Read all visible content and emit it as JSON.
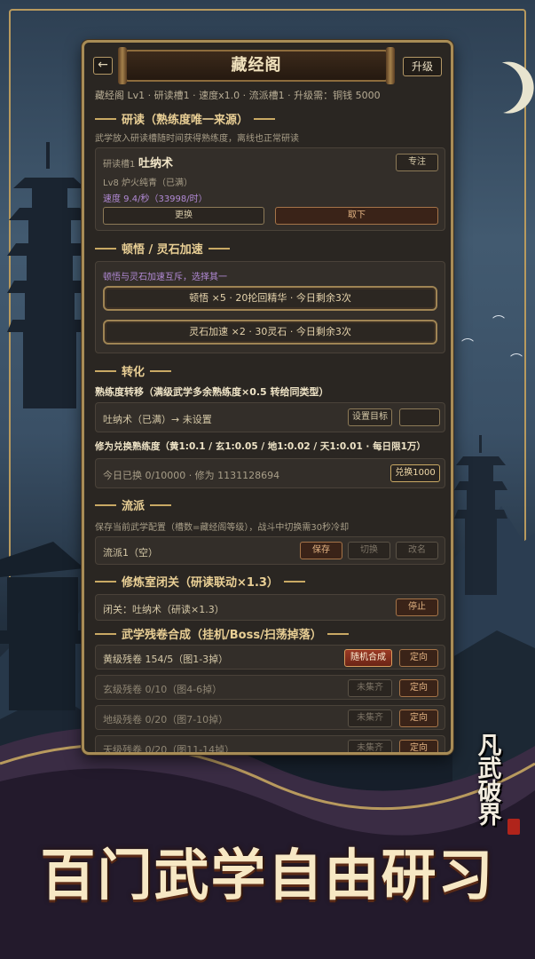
{
  "panel": {
    "back_glyph": "←",
    "title": "藏经阁",
    "upgrade_label": "升级",
    "status": "藏经阁 Lv1 · 研读槽1 · 速度x1.0 · 流派槽1 · 升级需：铜钱 5000"
  },
  "study": {
    "heading": "研读（熟练度唯一来源）",
    "note": "武学放入研读槽随时间获得熟练度，离线也正常研读",
    "slot_label": "研读槽1",
    "skill_name": "吐纳术",
    "detail_btn": "专注",
    "level_text": "Lv8 炉火纯青（已满）",
    "speed_text": "速度 9.4/秒（33998/时）",
    "swap_btn": "更换",
    "remove_btn": "取下"
  },
  "boost": {
    "heading": "顿悟 / 灵石加速",
    "note": "顿悟与灵石加速互斥，选择其一",
    "option1": "顿悟 ×5 · 20抡回精华 · 今日剩余3次",
    "option2": "灵石加速 ×2 · 30灵石 · 今日剩余3次"
  },
  "transform": {
    "heading": "转化",
    "transfer_title": "熟练度转移（满级武学多余熟练度×0.5 转给同类型）",
    "transfer_row": "吐纳术（已满）→ 未设置",
    "set_target_btn": "设置目标",
    "empty_btn": "",
    "exchange_title": "修为兑换熟练度（黄1:0.1 / 玄1:0.05 / 地1:0.02 / 天1:0.01 · 每日限1万）",
    "exchange_row": "今日已换 0/10000 · 修为 1131128694",
    "exchange_btn": "兑换1000"
  },
  "school": {
    "heading": "流派",
    "note": "保存当前武学配置（槽数=藏经阁等级），战斗中切换需30秒冷却",
    "row": "流派1（空）",
    "save_btn": "保存",
    "switch_btn": "切换",
    "rename_btn": "改名"
  },
  "retreat": {
    "heading": "修炼室闭关（研读联动×1.3）",
    "row": "闭关：吐纳术（研读×1.3）",
    "stop_btn": "停止"
  },
  "scroll": {
    "heading": "武学残卷合成（挂机/Boss/扫荡掉落）",
    "rows": [
      {
        "text": "黄级残卷 154/5（图1-3掉）",
        "action": "随机合成",
        "locate": "定向"
      },
      {
        "text": "玄级残卷 0/10（图4-6掉）",
        "action": "未集齐",
        "locate": "定向"
      },
      {
        "text": "地级残卷 0/20（图7-10掉）",
        "action": "未集齐",
        "locate": "定向"
      },
      {
        "text": "天级残卷 0/20（图11-14掉）",
        "action": "未集齐",
        "locate": "定向"
      }
    ]
  },
  "promo": {
    "slogan": "百门武学自由研习",
    "logo_lines": [
      "凡",
      "武",
      "破",
      "界"
    ]
  },
  "colors": {
    "gold": "#c9a964",
    "panel_bg": "#2a2622",
    "red_button": "#9b3a25"
  }
}
